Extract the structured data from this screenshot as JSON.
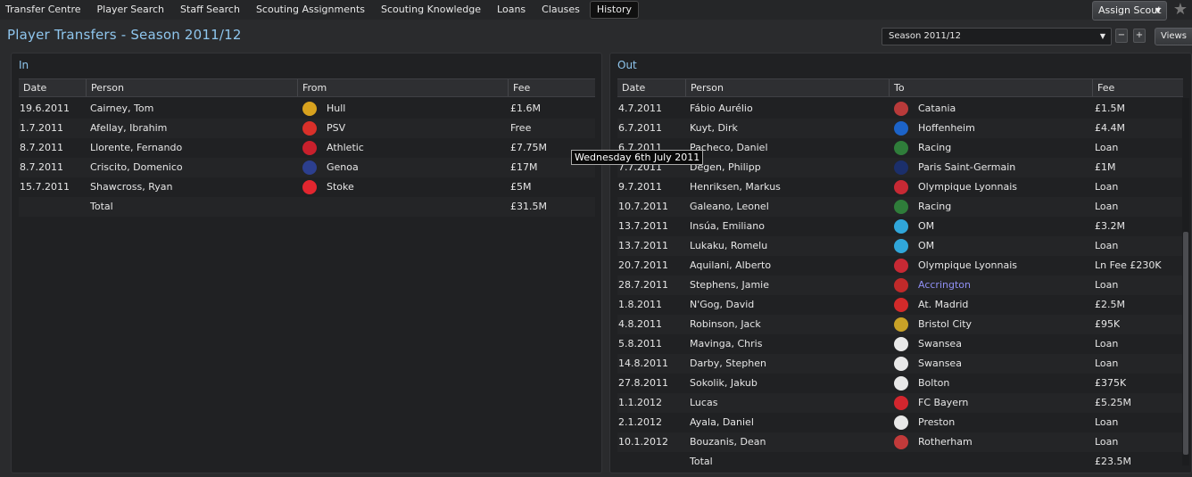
{
  "nav": {
    "items": [
      {
        "label": "Transfer Centre"
      },
      {
        "label": "Player Search"
      },
      {
        "label": "Staff Search"
      },
      {
        "label": "Scouting Assignments"
      },
      {
        "label": "Scouting Knowledge"
      },
      {
        "label": "Loans"
      },
      {
        "label": "Clauses"
      },
      {
        "label": "History",
        "active": true
      }
    ],
    "assign_scout": "Assign Scout",
    "views": "Views"
  },
  "title": "Player Transfers - Season 2011/12",
  "season_select": {
    "value": "Season 2011/12"
  },
  "tooltip": "Wednesday 6th July 2011",
  "in_panel": {
    "title": "In",
    "headers": {
      "date": "Date",
      "person": "Person",
      "club": "From",
      "fee": "Fee"
    },
    "rows": [
      {
        "date": "19.6.2011",
        "person": "Cairney, Tom",
        "club": "Hull",
        "fee": "£1.6M",
        "crest": "#d8a21e"
      },
      {
        "date": "1.7.2011",
        "person": "Afellay, Ibrahim",
        "club": "PSV",
        "fee": "Free",
        "crest": "#d9302a"
      },
      {
        "date": "8.7.2011",
        "person": "Llorente, Fernando",
        "club": "Athletic",
        "fee": "£7.75M",
        "crest": "#c8202c"
      },
      {
        "date": "8.7.2011",
        "person": "Criscito, Domenico",
        "club": "Genoa",
        "fee": "£17M",
        "crest": "#2c3f8f"
      },
      {
        "date": "15.7.2011",
        "person": "Shawcross, Ryan",
        "club": "Stoke",
        "fee": "£5M",
        "crest": "#e2262f"
      }
    ],
    "total_label": "Total",
    "total_fee": "£31.5M"
  },
  "out_panel": {
    "title": "Out",
    "headers": {
      "date": "Date",
      "person": "Person",
      "club": "To",
      "fee": "Fee"
    },
    "rows": [
      {
        "date": "4.7.2011",
        "person": "Fábio Aurélio",
        "club": "Catania",
        "fee": "£1.5M",
        "crest": "#b83a3a"
      },
      {
        "date": "6.7.2011",
        "person": "Kuyt, Dirk",
        "club": "Hoffenheim",
        "fee": "£4.4M",
        "crest": "#1c63c8"
      },
      {
        "date": "6.7.2011",
        "person": "Pacheco, Daniel",
        "club": "Racing",
        "fee": "Loan",
        "crest": "#2f7d3a"
      },
      {
        "date": "7.7.2011",
        "person": "Degen, Philipp",
        "club": "Paris Saint-Germain",
        "fee": "£1M",
        "crest": "#1b2f6b"
      },
      {
        "date": "9.7.2011",
        "person": "Henriksen, Markus",
        "club": "Olympique Lyonnais",
        "fee": "Loan",
        "crest": "#c72934"
      },
      {
        "date": "10.7.2011",
        "person": "Galeano, Leonel",
        "club": "Racing",
        "fee": "Loan",
        "crest": "#2f7d3a"
      },
      {
        "date": "13.7.2011",
        "person": "Insúa, Emiliano",
        "club": "OM",
        "fee": "£3.2M",
        "crest": "#30a6da"
      },
      {
        "date": "13.7.2011",
        "person": "Lukaku, Romelu",
        "club": "OM",
        "fee": "Loan",
        "crest": "#30a6da"
      },
      {
        "date": "20.7.2011",
        "person": "Aquilani, Alberto",
        "club": "Olympique Lyonnais",
        "fee": "Ln Fee £230K",
        "crest": "#c72934"
      },
      {
        "date": "28.7.2011",
        "person": "Stephens, Jamie",
        "club": "Accrington",
        "fee": "Loan",
        "crest": "#c02a2a",
        "link": true
      },
      {
        "date": "1.8.2011",
        "person": "N'Gog, David",
        "club": "At. Madrid",
        "fee": "£2.5M",
        "crest": "#d22a2a"
      },
      {
        "date": "4.8.2011",
        "person": "Robinson, Jack",
        "club": "Bristol City",
        "fee": "£95K",
        "crest": "#c9a227"
      },
      {
        "date": "5.8.2011",
        "person": "Mavinga, Chris",
        "club": "Swansea",
        "fee": "Loan",
        "crest": "#e8e8e8"
      },
      {
        "date": "14.8.2011",
        "person": "Darby, Stephen",
        "club": "Swansea",
        "fee": "Loan",
        "crest": "#e8e8e8"
      },
      {
        "date": "27.8.2011",
        "person": "Sokolik, Jakub",
        "club": "Bolton",
        "fee": "£375K",
        "crest": "#e8e8e8"
      },
      {
        "date": "1.1.2012",
        "person": "Lucas",
        "club": "FC Bayern",
        "fee": "£5.25M",
        "crest": "#d3262e"
      },
      {
        "date": "2.1.2012",
        "person": "Ayala, Daniel",
        "club": "Preston",
        "fee": "Loan",
        "crest": "#e8e8e8"
      },
      {
        "date": "10.1.2012",
        "person": "Bouzanis, Dean",
        "club": "Rotherham",
        "fee": "Loan",
        "crest": "#c23a3a"
      }
    ],
    "total_label": "Total",
    "total_fee": "£23.5M"
  }
}
